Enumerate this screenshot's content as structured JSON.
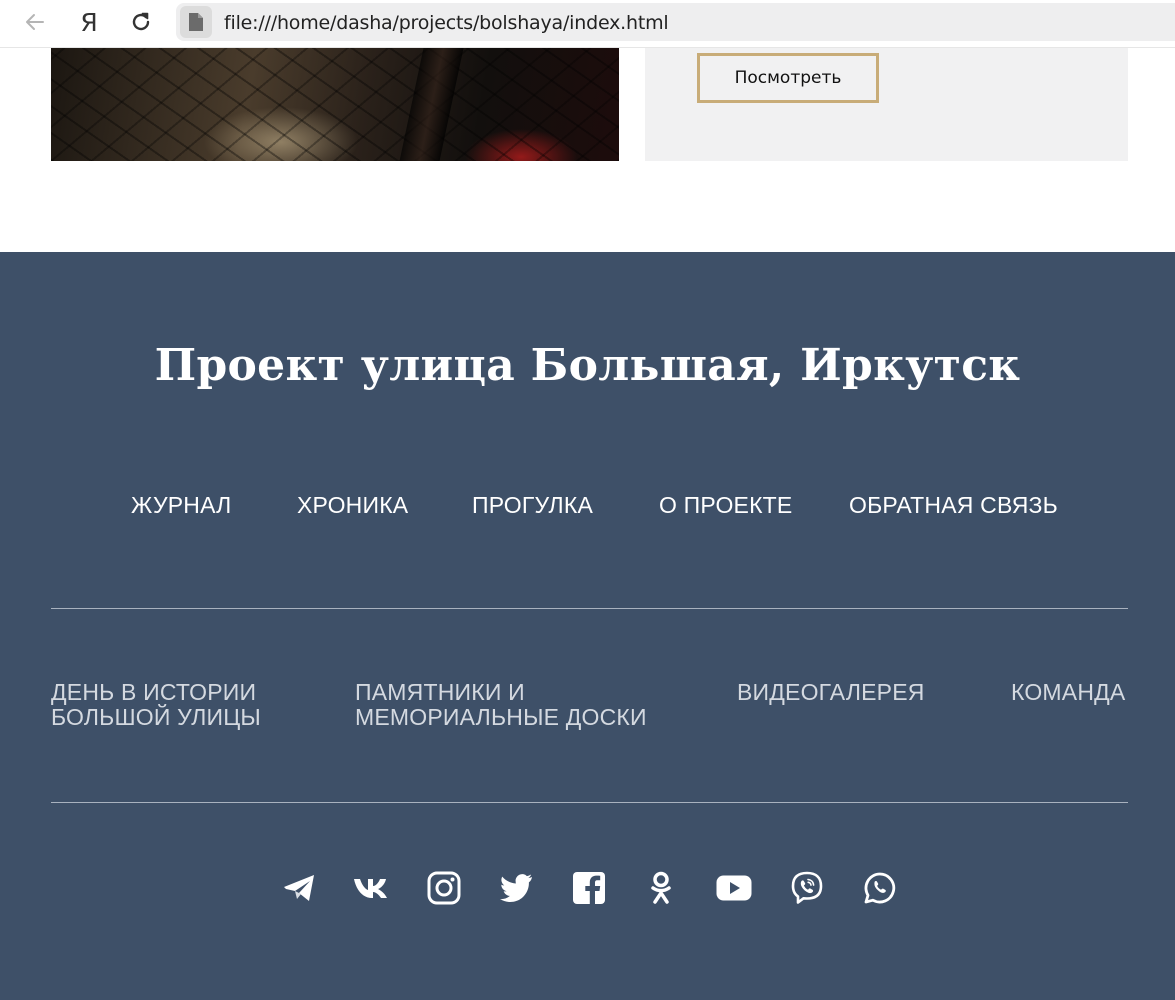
{
  "browser": {
    "url": "file:///home/dasha/projects/bolshaya/index.html",
    "yandex_label": "Я"
  },
  "card": {
    "button_label": "Посмотреть"
  },
  "footer": {
    "title": "Проект улица Большая, Иркутск",
    "main_nav": [
      "ЖУРНАЛ",
      "ХРОНИКА",
      "ПРОГУЛКА",
      "О ПРОЕКТЕ",
      "ОБРАТНАЯ СВЯЗЬ"
    ],
    "secondary_nav": [
      {
        "line1": "ДЕНЬ В ИСТОРИИ",
        "line2": "БОЛЬШОЙ УЛИЦЫ"
      },
      {
        "line1": "ПАМЯТНИКИ И",
        "line2": "МЕМОРИАЛЬНЫЕ ДОСКИ"
      },
      {
        "line1": "ВИДЕОГАЛЕРЕЯ",
        "line2": ""
      },
      {
        "line1": "КОМАНДА",
        "line2": ""
      }
    ],
    "social": [
      "telegram-icon",
      "vk-icon",
      "instagram-icon",
      "twitter-icon",
      "facebook-icon",
      "odnoklassniki-icon",
      "youtube-icon",
      "viber-icon",
      "whatsapp-icon"
    ]
  },
  "colors": {
    "footer_bg": "#3e5068",
    "button_border": "#c8ac78",
    "card_bg": "#f1f1f2"
  }
}
